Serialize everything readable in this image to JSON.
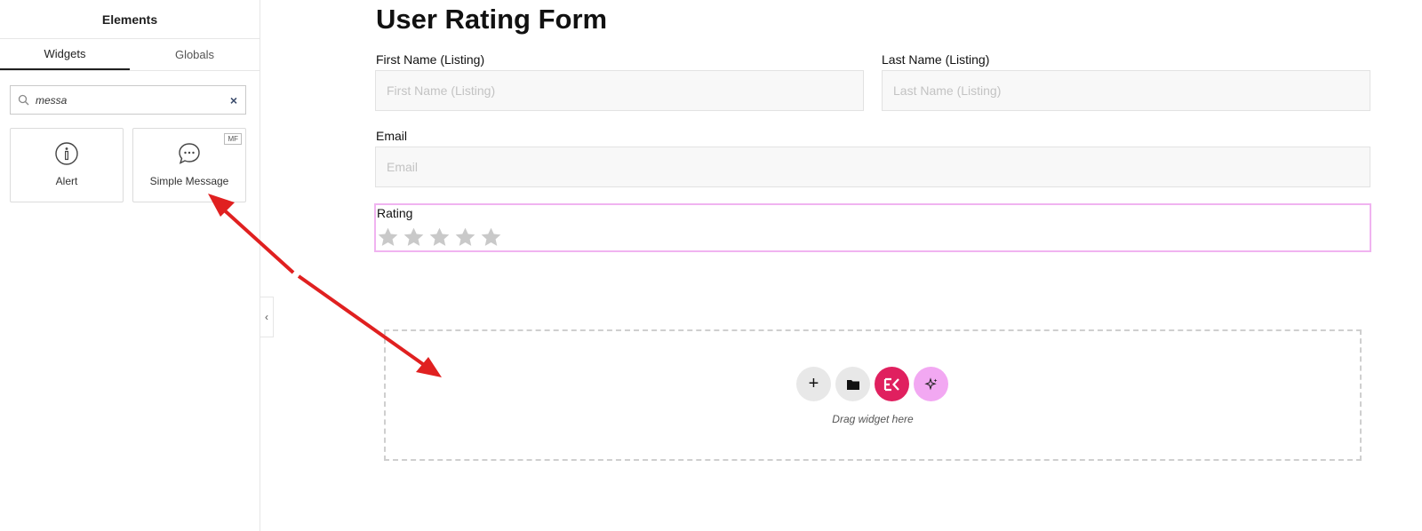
{
  "sidebar": {
    "title": "Elements",
    "tabs": [
      {
        "label": "Widgets"
      },
      {
        "label": "Globals"
      }
    ],
    "search": {
      "value": "messa",
      "clear_label": "×"
    },
    "widgets": [
      {
        "label": "Alert",
        "icon": "info-icon"
      },
      {
        "label": "Simple Message",
        "icon": "chat-bubble-icon",
        "badge": "MF"
      }
    ],
    "collapse_label": "‹"
  },
  "form": {
    "title": "User Rating Form",
    "fields": {
      "first_name": {
        "label": "First Name (Listing)",
        "placeholder": "First Name (Listing)"
      },
      "last_name": {
        "label": "Last Name (Listing)",
        "placeholder": "Last Name (Listing)"
      },
      "email": {
        "label": "Email",
        "placeholder": "Email"
      }
    },
    "rating": {
      "label": "Rating",
      "stars_total": 5,
      "stars_filled": 0
    }
  },
  "drop_zone": {
    "add_label": "+",
    "ek_label": "EK",
    "text": "Drag widget here"
  },
  "colors": {
    "rating_border": "#f0b3f0",
    "ek_button": "#e0205f",
    "ai_button": "#f2a8f2",
    "annotation_arrow": "#e02020"
  }
}
